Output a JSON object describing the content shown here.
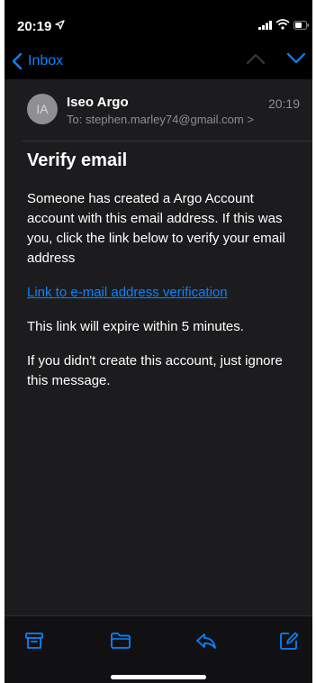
{
  "status_bar": {
    "time": "20:19"
  },
  "nav": {
    "back_label": "Inbox"
  },
  "message": {
    "avatar_initials": "IA",
    "sender": "Iseo Argo",
    "time": "20:19",
    "to_line": "To: stephen.marley74@gmail.com >",
    "subject": "Verify email",
    "paragraph1": "Someone has created a Argo Account account with this email address. If this was you, click the link below to verify your email address",
    "link_text": "Link to e-mail address verification",
    "paragraph2": "This link will expire within 5 minutes.",
    "paragraph3": "If you didn't create this account, just ignore this message."
  },
  "toolbar": {
    "items": [
      "archive-icon",
      "folder-icon",
      "reply-icon",
      "compose-icon"
    ]
  },
  "colors": {
    "accent": "#0a84ff",
    "background": "#1c1c1e",
    "secondary_text": "#8e8e93"
  }
}
